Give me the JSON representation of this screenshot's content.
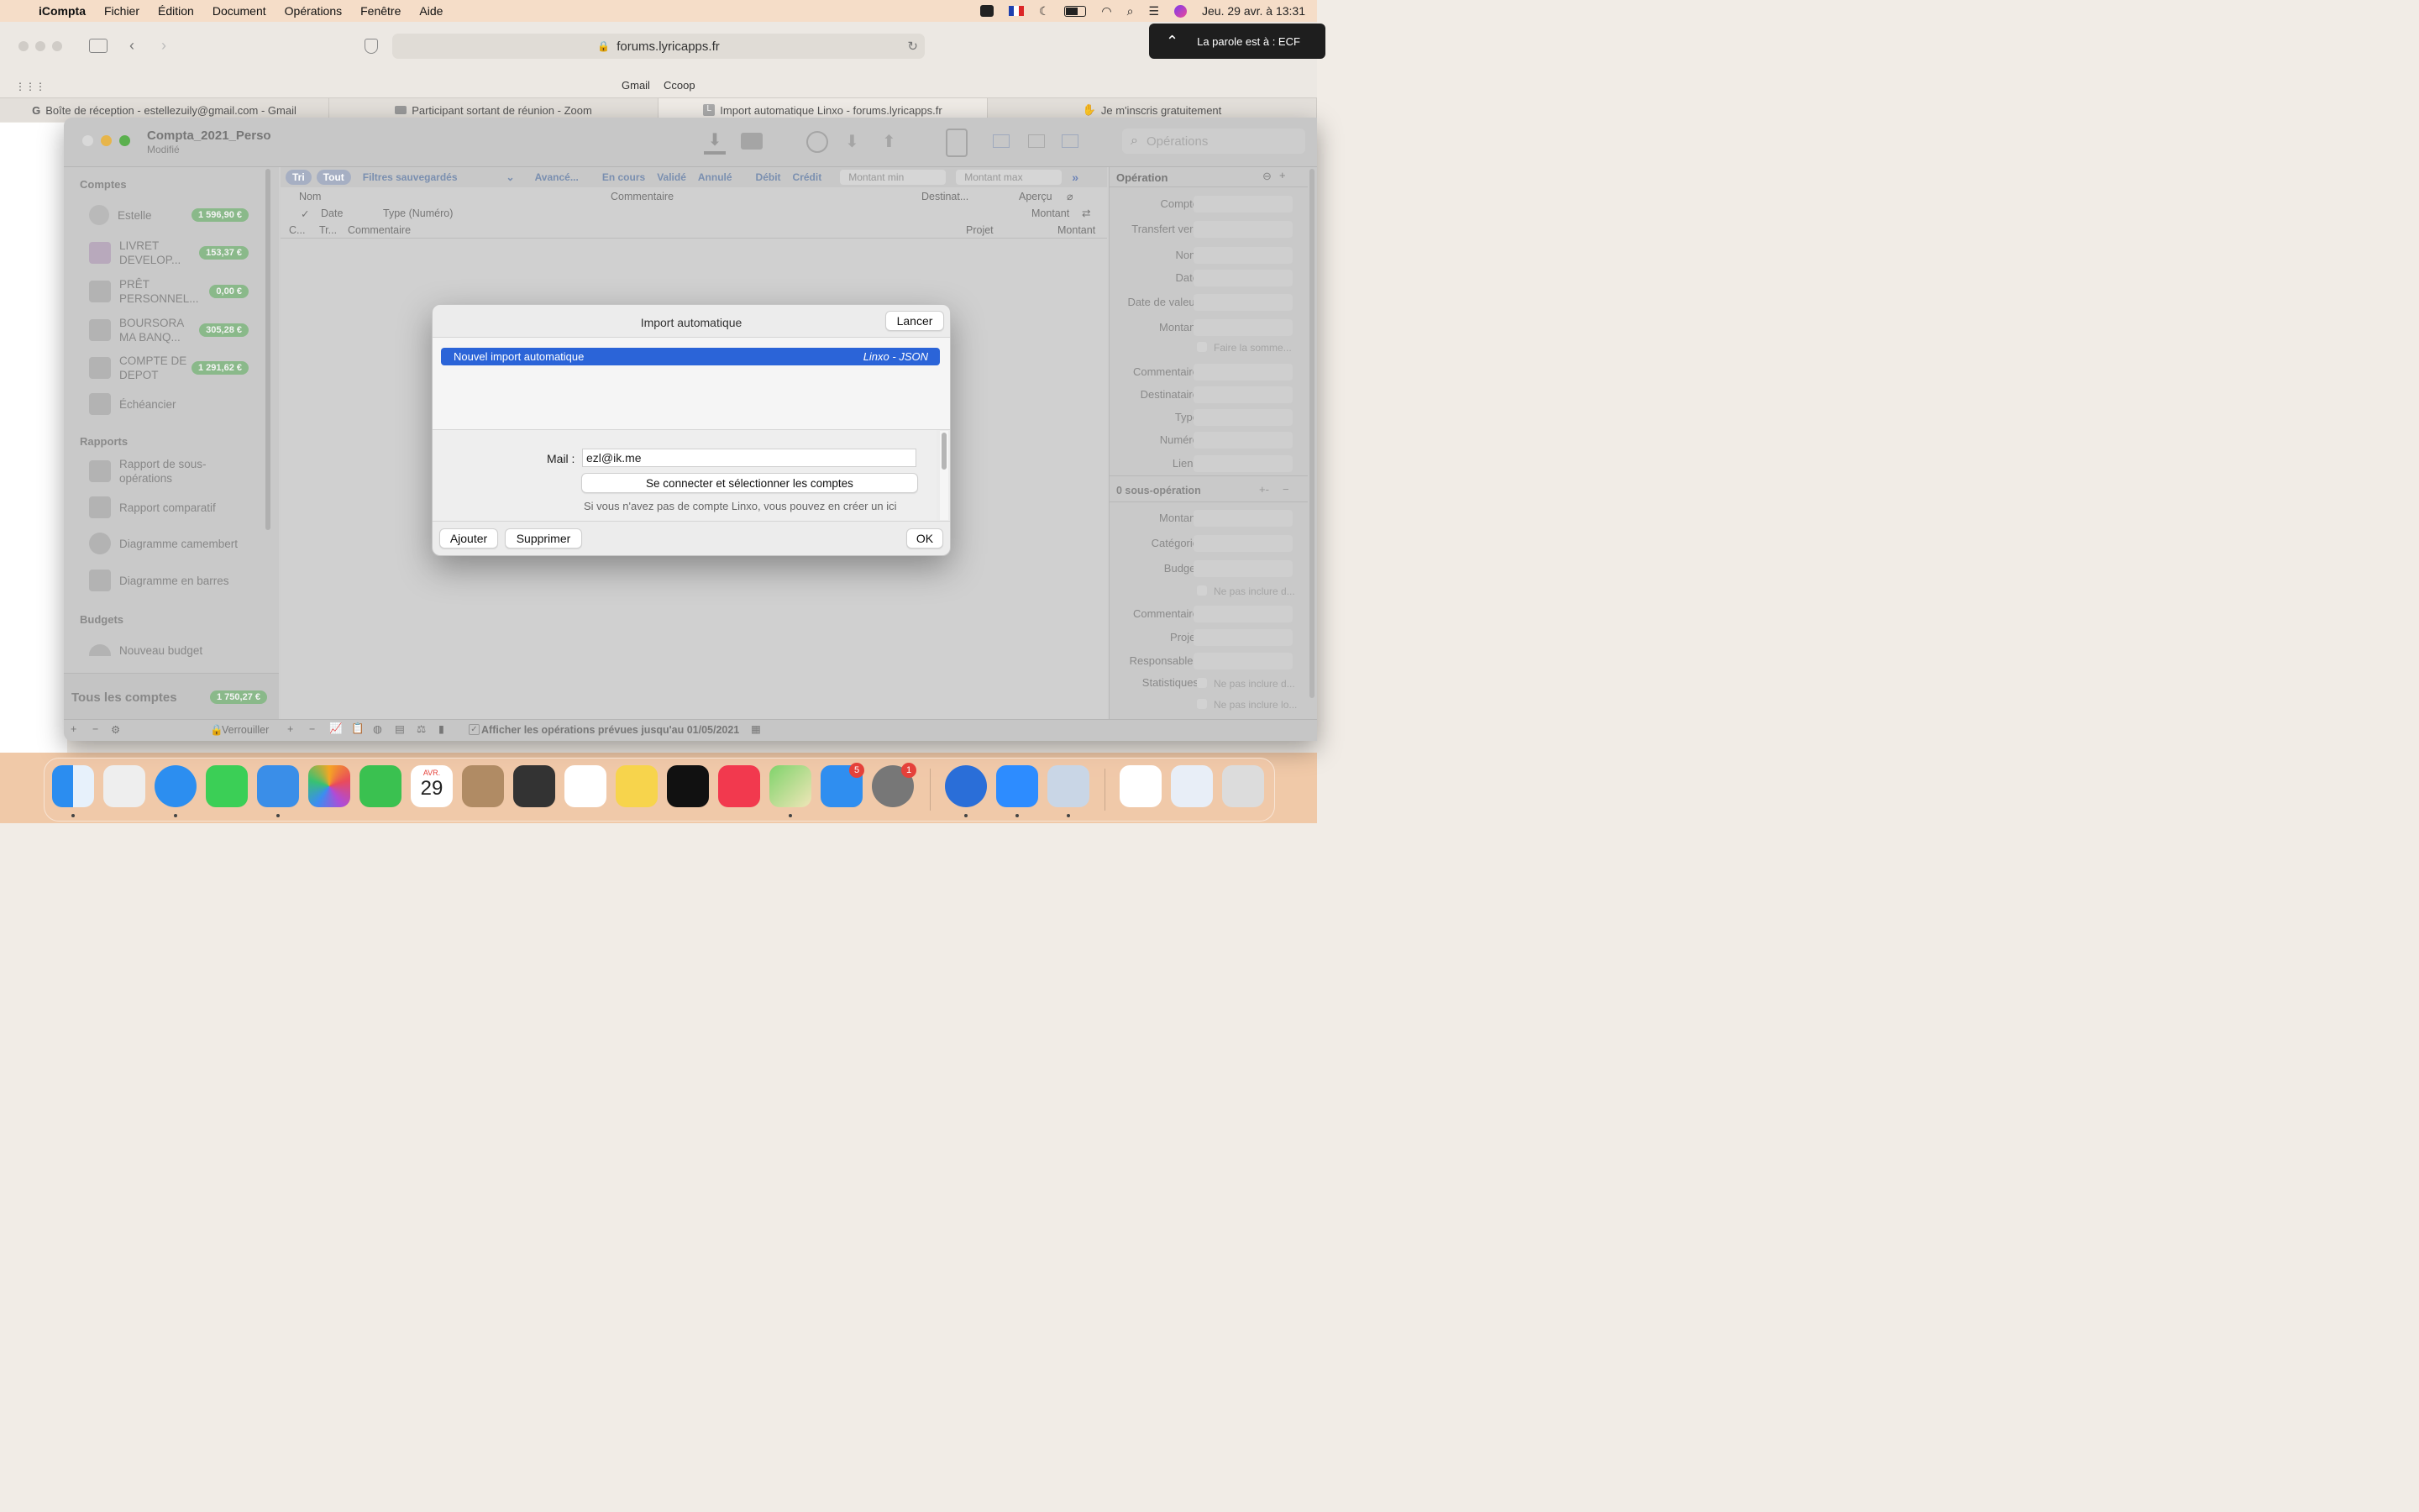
{
  "menubar": {
    "app": "iCompta",
    "items": [
      "Fichier",
      "Édition",
      "Document",
      "Opérations",
      "Fenêtre",
      "Aide"
    ],
    "clock": "Jeu. 29 avr. à  13:31"
  },
  "browser": {
    "url": "forums.lyricapps.fr",
    "bookmarks": [
      "Gmail",
      "Ccoop"
    ],
    "tabs": [
      {
        "label": "Boîte de réception - estellezuily@gmail.com - Gmail",
        "icon": "google-icon"
      },
      {
        "label": "Participant sortant de réunion - Zoom",
        "icon": "zoom-icon"
      },
      {
        "label": "Import automatique Linxo - forums.lyricapps.fr",
        "icon": "l-icon"
      },
      {
        "label": "Je m'inscris gratuitement",
        "icon": "handshake-icon"
      }
    ],
    "notification": "La parole est à : ECF"
  },
  "app": {
    "doc_title": "Compta_2021_Perso",
    "doc_status": "Modifié",
    "search_placeholder": "Opérations",
    "sidebar": {
      "accounts_header": "Comptes",
      "accounts": [
        {
          "label": "Estelle",
          "balance": "1 596,90 €"
        },
        {
          "label": "LIVRET DEVELOP...",
          "balance": "153,37 €"
        },
        {
          "label": "PRÊT PERSONNEL...",
          "balance": "0,00 €"
        },
        {
          "label": "BOURSORA MA BANQ...",
          "balance": "305,28 €"
        },
        {
          "label": "COMPTE DE DEPOT",
          "balance": "1 291,62 €"
        }
      ],
      "scheduler": "Échéancier",
      "reports_header": "Rapports",
      "reports": [
        "Rapport de sous-opérations",
        "Rapport comparatif",
        "Diagramme camembert",
        "Diagramme en barres"
      ],
      "budgets_header": "Budgets",
      "new_budget": "Nouveau budget",
      "all_accounts": "Tous les comptes",
      "all_accounts_balance": "1 750,27 €",
      "lock": "Verrouiller"
    },
    "filters": {
      "sort": "Tri",
      "all": "Tout",
      "saved": "Filtres sauvegardés",
      "advanced": "Avancé...",
      "in_progress": "En cours",
      "validated": "Validé",
      "cancelled": "Annulé",
      "debit": "Débit",
      "credit": "Crédit",
      "min_placeholder": "Montant min",
      "max_placeholder": "Montant max"
    },
    "columns": {
      "row1": [
        "Nom",
        "Commentaire",
        "Destinat...",
        "Aperçu"
      ],
      "row2": [
        "✓",
        "Date",
        "Type (Numéro)",
        "Montant"
      ],
      "row3": [
        "C...",
        "Tr...",
        "Commentaire",
        "Projet",
        "Montant"
      ]
    },
    "inspector": {
      "header": "Opération",
      "fields": [
        "Compte",
        "Transfert vers",
        "Nom",
        "Date",
        "Date de valeur",
        "Montant"
      ],
      "sum_checkbox": "Faire la somme...",
      "fields2": [
        "Commentaire",
        "Destinataire",
        "Type",
        "Numéro",
        "Liens"
      ],
      "sub_header": "0 sous-opération",
      "sub_fields": [
        "Montant",
        "Catégorie",
        "Budget"
      ],
      "exclude1": "Ne pas inclure d...",
      "sub_fields2": [
        "Commentaire",
        "Projet",
        "Responsables",
        "Statistiques"
      ],
      "exclude2": "Ne pas inclure d...",
      "exclude3": "Ne pas inclure lo..."
    },
    "footer": {
      "show_planned": "Afficher les opérations prévues jusqu'au 01/05/2021"
    }
  },
  "dialog": {
    "title": "Import automatique",
    "launch_button": "Lancer",
    "selected_import": "Nouvel import automatique",
    "selected_type": "Linxo - JSON",
    "mail_label": "Mail :",
    "mail_value": "ezl@ik.me",
    "connect_button": "Se connecter et sélectionner les comptes",
    "hint": "Si vous n'avez pas de compte Linxo, vous pouvez en créer un ici",
    "add_button": "Ajouter",
    "delete_button": "Supprimer",
    "ok_button": "OK"
  },
  "dock": {
    "calendar_month": "AVR.",
    "calendar_day": "29",
    "appstore_badge": "5",
    "settings_badge": "1"
  },
  "colors": {
    "accent": "#2b64d8",
    "menubar": "#f5ddc8",
    "badge_green": "#8ab98a"
  }
}
